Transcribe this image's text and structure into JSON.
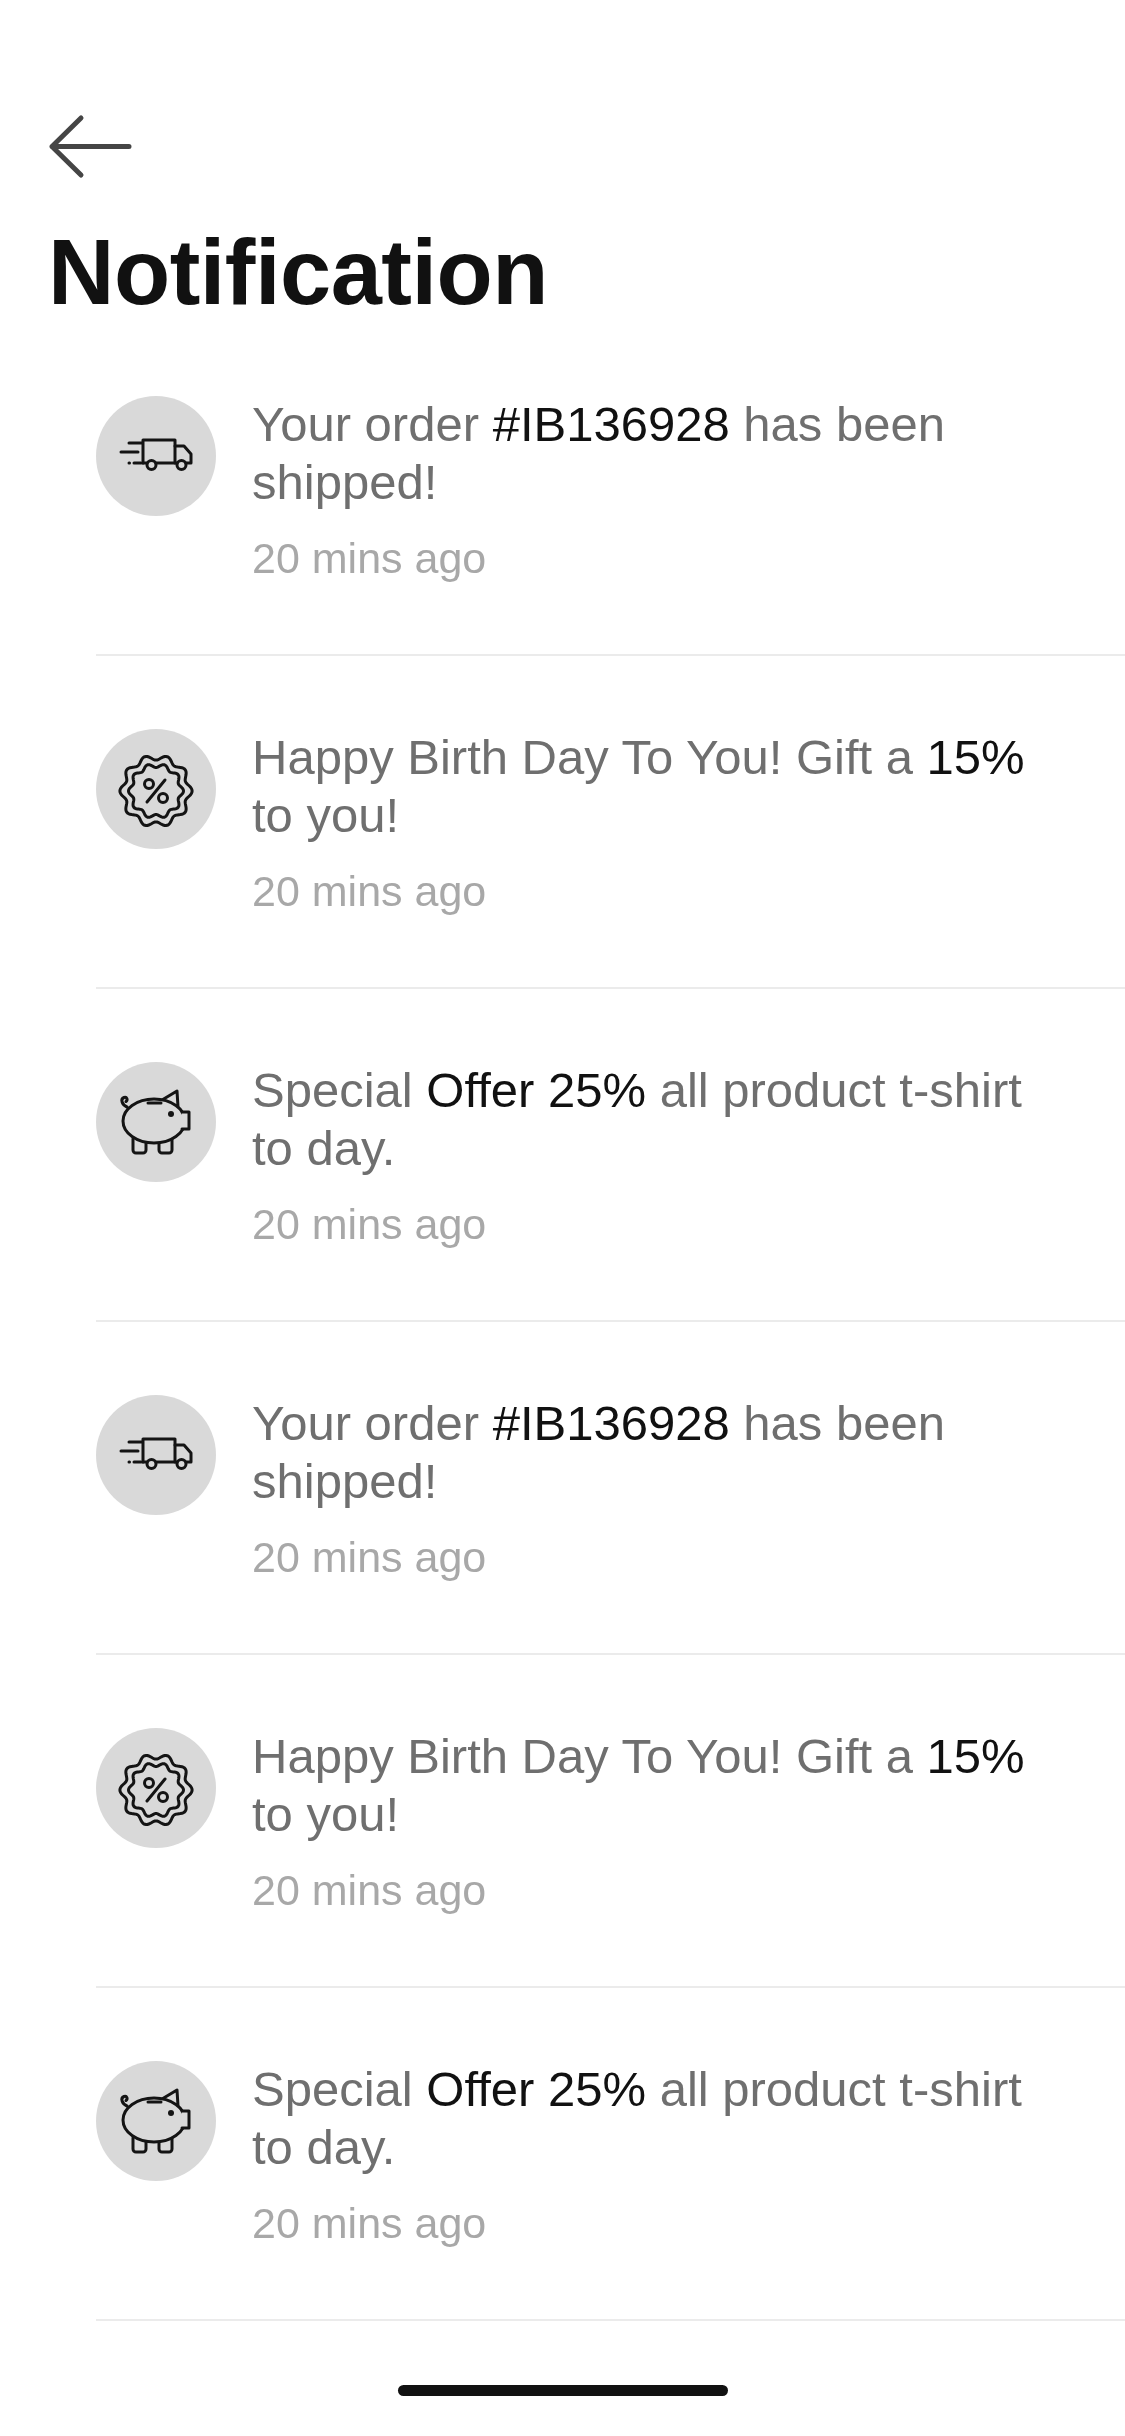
{
  "title": "Notification",
  "notifications": [
    {
      "kind": "order",
      "message": [
        {
          "text": "Your order ",
          "emphasis": false
        },
        {
          "text": "#IB136928",
          "emphasis": true
        },
        {
          "text": " has been shipped!",
          "emphasis": false
        }
      ],
      "time": "20 mins ago"
    },
    {
      "kind": "birthday",
      "message": [
        {
          "text": "Happy Birth Day To You! Gift a ",
          "emphasis": false
        },
        {
          "text": "15%",
          "emphasis": true
        },
        {
          "text": " to you!",
          "emphasis": false
        }
      ],
      "time": "20 mins ago"
    },
    {
      "kind": "offer",
      "message": [
        {
          "text": "Special ",
          "emphasis": false
        },
        {
          "text": "Offer 25%",
          "emphasis": true
        },
        {
          "text": " all product t-shirt to day.",
          "emphasis": false
        }
      ],
      "time": "20 mins ago"
    },
    {
      "kind": "order",
      "message": [
        {
          "text": "Your order ",
          "emphasis": false
        },
        {
          "text": "#IB136928",
          "emphasis": true
        },
        {
          "text": " has been shipped!",
          "emphasis": false
        }
      ],
      "time": "20 mins ago"
    },
    {
      "kind": "birthday",
      "message": [
        {
          "text": "Happy Birth Day To You! Gift a ",
          "emphasis": false
        },
        {
          "text": "15%",
          "emphasis": true
        },
        {
          "text": " to you!",
          "emphasis": false
        }
      ],
      "time": "20 mins ago"
    },
    {
      "kind": "offer",
      "message": [
        {
          "text": "Special ",
          "emphasis": false
        },
        {
          "text": "Offer 25%",
          "emphasis": true
        },
        {
          "text": " all product t-shirt to day.",
          "emphasis": false
        }
      ],
      "time": "20 mins ago"
    }
  ]
}
